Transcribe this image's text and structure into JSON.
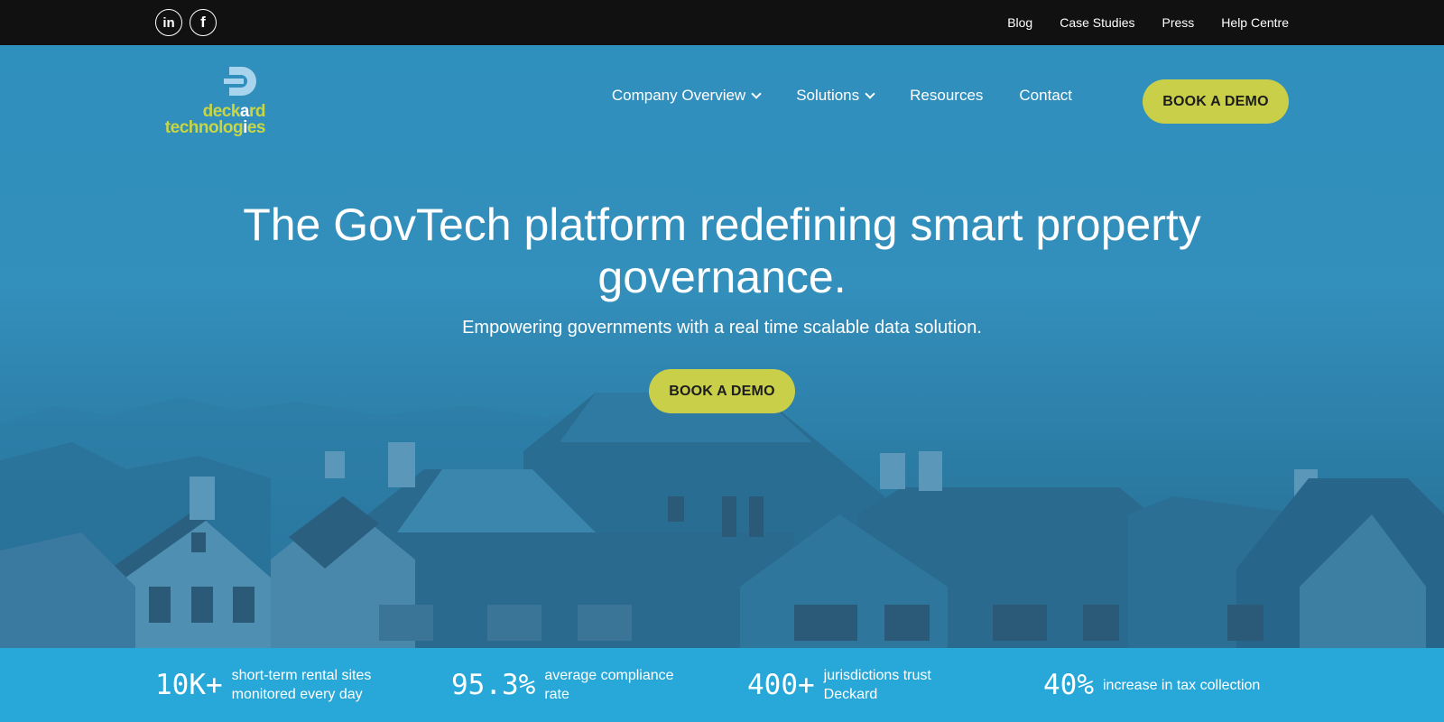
{
  "social": {
    "linkedin_glyph": "in",
    "facebook_glyph": "f"
  },
  "utility_nav": [
    "Blog",
    "Case Studies",
    "Press",
    "Help Centre"
  ],
  "logo": {
    "line1_a": "deck",
    "line1_b": "a",
    "line1_c": "rd",
    "line2_a": "technolog",
    "line2_b": "i",
    "line2_c": "es"
  },
  "nav": {
    "company_overview": "Company Overview",
    "solutions": "Solutions",
    "resources": "Resources",
    "contact": "Contact",
    "cta": "BOOK A DEMO"
  },
  "hero": {
    "headline_line1": "The GovTech platform redefining smart property",
    "headline_line2": "governance.",
    "subline": "Empowering governments with a real time scalable data solution.",
    "cta": "BOOK A DEMO"
  },
  "stats": [
    {
      "value": "10K+",
      "line1": "short-term rental sites",
      "line2": "monitored every day"
    },
    {
      "value": "95.3%",
      "line1": "average compliance",
      "line2": "rate"
    },
    {
      "value": "400+",
      "line1": "jurisdictions trust",
      "line2": "Deckard"
    },
    {
      "value": "40%",
      "line1": "increase in tax collection",
      "line2": ""
    }
  ],
  "colors": {
    "accent": "#c9cf49",
    "logo_green": "#c9d644",
    "topbar": "#111111",
    "hero_blue": "#2f8fbd",
    "stats_bar": "#28a8d9"
  }
}
